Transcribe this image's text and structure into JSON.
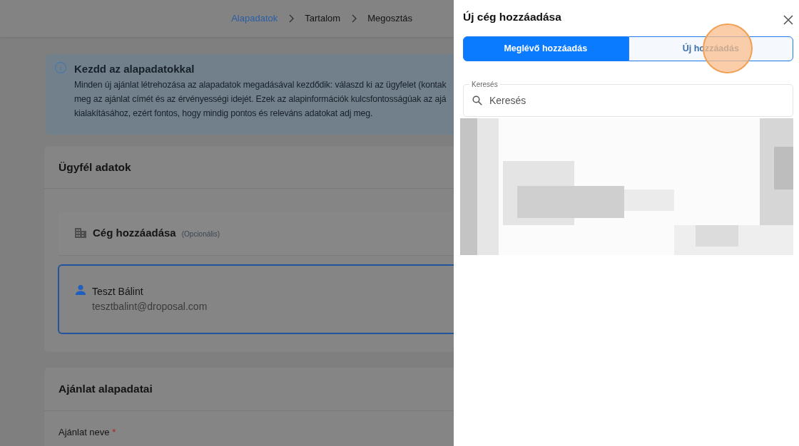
{
  "breadcrumb": [
    {
      "label": "Alapadatok",
      "selected": true
    },
    {
      "label": "Tartalom",
      "selected": false
    },
    {
      "label": "Megosztás",
      "selected": false
    }
  ],
  "info": {
    "title": "Kezdd az alapadatokkal",
    "lines": [
      "Minden új ajánlat létrehozása az alapadatok megadásával kezdődik: válaszd ki az ügyfelet (kontak",
      "meg az ajánlat címét és az érvényességi idejét. Ezek az alapinformációk kulcsfontosságúak az ajá",
      "kialakításához, ezért fontos, hogy mindig pontos és releváns adatokat adj meg."
    ]
  },
  "client_card": {
    "title": "Ügyfél adatok",
    "company": {
      "label": "Cég hozzáadása",
      "hint": "(Opcionális)"
    },
    "contacts": [
      {
        "name": "Teszt Bálint",
        "email": "tesztbalint@droposal.com",
        "selected": true
      }
    ]
  },
  "offer_card": {
    "title": "Ajánlat alapadatai",
    "fields": [
      {
        "label": "Ajánlat neve",
        "required_mark": "*"
      }
    ]
  },
  "drawer": {
    "title": "Új cég hozzáadása",
    "tabs": [
      {
        "label": "Meglévő hozzáadás",
        "selected": true
      },
      {
        "label": "Új hozzáadás",
        "selected": false
      }
    ],
    "search": {
      "label": "Keresés",
      "placeholder": "Keresés"
    }
  }
}
